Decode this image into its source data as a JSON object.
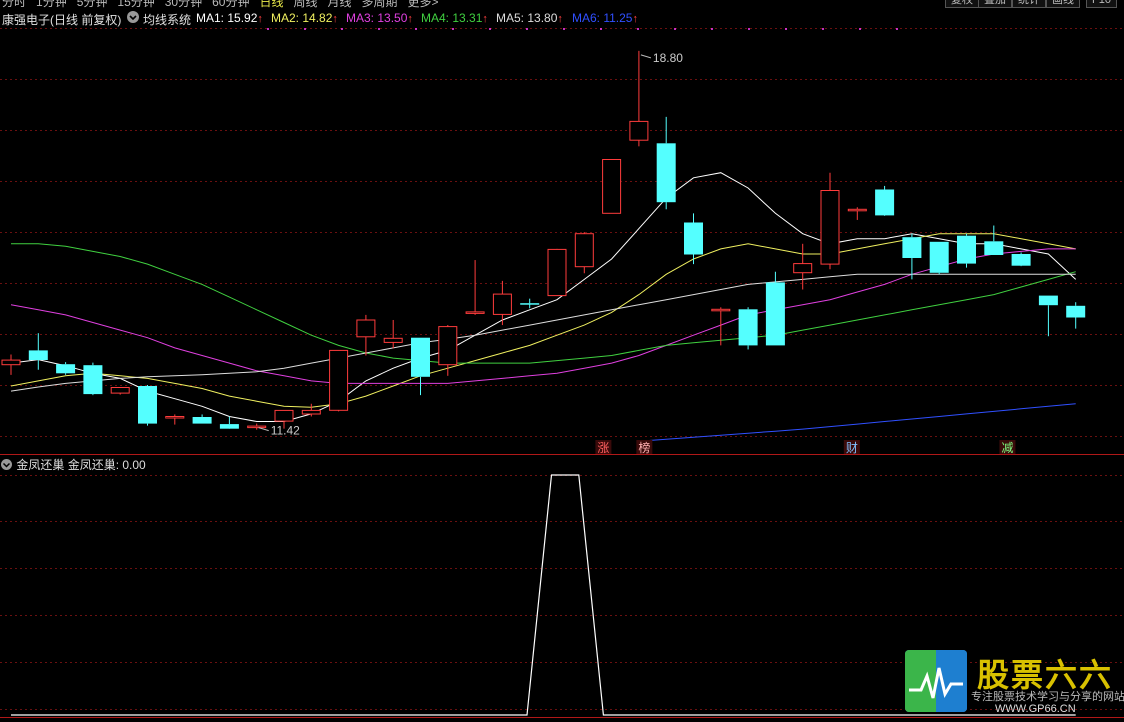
{
  "toolbar": {
    "periods": [
      "分时",
      "1分钟",
      "5分钟",
      "15分钟",
      "30分钟",
      "60分钟",
      "日线",
      "周线",
      "月线",
      "多周期",
      "更多>"
    ],
    "active_period": "日线",
    "right_buttons": [
      "复权",
      "叠加",
      "统计",
      "画线",
      "F10"
    ]
  },
  "header": {
    "stock": "康强电子(日线 前复权)",
    "indicator": "均线系统",
    "ma": [
      {
        "label": "MA1: 15.92",
        "color": "#ffffff"
      },
      {
        "label": "MA2: 14.82",
        "color": "#f0f060"
      },
      {
        "label": "MA3: 13.50",
        "color": "#e040e0"
      },
      {
        "label": "MA4: 13.31",
        "color": "#40d040"
      },
      {
        "label": "MA5: 13.80",
        "color": "#dddddd"
      },
      {
        "label": "MA6: 11.25",
        "color": "#3050ff"
      }
    ],
    "up_arrow": "↑"
  },
  "indicator_panel": {
    "name": "金凤还巢",
    "value_label": "金凤还巢: 0.00"
  },
  "logo": {
    "title": "股票六六",
    "subtitle": "专注股票技术学习与分享的网站",
    "url": "WWW.GP66.CN"
  },
  "chart_data": [
    {
      "type": "candlestick",
      "title": "康强电子(日线 前复权)",
      "ylim": [
        10.9,
        19.25
      ],
      "annotations": {
        "high": "18.80",
        "low": "11.42"
      },
      "colors": {
        "up": "#ff3c3c",
        "down": "#54ffff",
        "grid": "#6a1010"
      },
      "candles": [
        {
          "o": 12.62,
          "h": 12.82,
          "l": 12.42,
          "c": 12.71
        },
        {
          "o": 12.9,
          "h": 13.24,
          "l": 12.52,
          "c": 12.71
        },
        {
          "o": 12.63,
          "h": 12.67,
          "l": 12.42,
          "c": 12.45
        },
        {
          "o": 12.61,
          "h": 12.66,
          "l": 12.02,
          "c": 12.04
        },
        {
          "o": 12.06,
          "h": 12.18,
          "l": 12.03,
          "c": 12.17
        },
        {
          "o": 12.2,
          "h": 12.22,
          "l": 11.42,
          "c": 11.46
        },
        {
          "o": 11.59,
          "h": 11.64,
          "l": 11.44,
          "c": 11.6
        },
        {
          "o": 11.59,
          "h": 11.64,
          "l": 11.46,
          "c": 11.46
        },
        {
          "o": 11.45,
          "h": 11.6,
          "l": 11.37,
          "c": 11.36
        },
        {
          "o": 11.41,
          "h": 11.46,
          "l": 11.34,
          "c": 11.41
        },
        {
          "o": 11.51,
          "h": 11.72,
          "l": 11.36,
          "c": 11.72
        },
        {
          "o": 11.65,
          "h": 11.85,
          "l": 11.6,
          "c": 11.72
        },
        {
          "o": 11.72,
          "h": 12.9,
          "l": 11.7,
          "c": 12.9
        },
        {
          "o": 13.17,
          "h": 13.6,
          "l": 12.8,
          "c": 13.5
        },
        {
          "o": 13.06,
          "h": 13.5,
          "l": 12.94,
          "c": 13.14
        },
        {
          "o": 13.15,
          "h": 13.15,
          "l": 12.02,
          "c": 12.38
        },
        {
          "o": 12.62,
          "h": 13.4,
          "l": 12.4,
          "c": 13.37
        },
        {
          "o": 13.66,
          "h": 14.68,
          "l": 13.6,
          "c": 13.66
        },
        {
          "o": 13.61,
          "h": 14.27,
          "l": 13.4,
          "c": 14.01
        },
        {
          "o": 13.83,
          "h": 13.92,
          "l": 13.73,
          "c": 13.82
        },
        {
          "o": 13.98,
          "h": 14.9,
          "l": 13.98,
          "c": 14.89
        },
        {
          "o": 14.55,
          "h": 15.23,
          "l": 14.42,
          "c": 15.2
        },
        {
          "o": 15.6,
          "h": 16.4,
          "l": 15.6,
          "c": 16.66
        },
        {
          "o": 17.04,
          "h": 18.8,
          "l": 16.92,
          "c": 17.41
        },
        {
          "o": 16.98,
          "h": 17.5,
          "l": 15.68,
          "c": 15.82
        },
        {
          "o": 15.42,
          "h": 15.6,
          "l": 14.6,
          "c": 14.79
        },
        {
          "o": 13.71,
          "h": 13.75,
          "l": 13.0,
          "c": 13.71
        },
        {
          "o": 13.71,
          "h": 13.75,
          "l": 12.92,
          "c": 13.0
        },
        {
          "o": 14.24,
          "h": 14.45,
          "l": 13.0,
          "c": 13.0
        },
        {
          "o": 14.43,
          "h": 15.0,
          "l": 14.1,
          "c": 14.61
        },
        {
          "o": 14.6,
          "h": 16.4,
          "l": 14.5,
          "c": 16.05
        },
        {
          "o": 15.68,
          "h": 15.72,
          "l": 15.47,
          "c": 15.68
        },
        {
          "o": 16.07,
          "h": 16.14,
          "l": 15.55,
          "c": 15.56
        },
        {
          "o": 15.13,
          "h": 15.2,
          "l": 14.3,
          "c": 14.72
        },
        {
          "o": 15.04,
          "h": 15.04,
          "l": 14.4,
          "c": 14.43
        },
        {
          "o": 15.16,
          "h": 15.2,
          "l": 14.53,
          "c": 14.61
        },
        {
          "o": 15.05,
          "h": 15.36,
          "l": 14.78,
          "c": 14.78
        },
        {
          "o": 14.8,
          "h": 14.83,
          "l": 14.56,
          "c": 14.57
        },
        {
          "o": 13.98,
          "h": 13.98,
          "l": 13.18,
          "c": 13.79
        },
        {
          "o": 13.78,
          "h": 13.85,
          "l": 13.33,
          "c": 13.55
        }
      ],
      "ma_series": [
        {
          "name": "MA1",
          "color": "#ffffff",
          "values": [
            12.65,
            12.72,
            12.6,
            12.45,
            12.35,
            12.1,
            11.95,
            11.8,
            11.6,
            11.5,
            11.5,
            11.65,
            11.9,
            12.3,
            12.55,
            12.75,
            12.9,
            13.2,
            13.5,
            13.7,
            13.9,
            14.3,
            14.7,
            15.3,
            15.9,
            16.3,
            16.4,
            16.1,
            15.6,
            15.2,
            15.0,
            15.1,
            15.1,
            15.2,
            15.1,
            15.0,
            15.0,
            14.9,
            14.8,
            14.3
          ]
        },
        {
          "name": "MA2",
          "color": "#f0f060",
          "values": [
            12.2,
            12.3,
            12.4,
            12.45,
            12.4,
            12.35,
            12.25,
            12.15,
            12.0,
            11.9,
            11.8,
            11.78,
            11.85,
            12.0,
            12.2,
            12.4,
            12.55,
            12.7,
            12.85,
            13.0,
            13.2,
            13.4,
            13.65,
            14.0,
            14.4,
            14.7,
            14.9,
            15.0,
            14.9,
            14.8,
            14.8,
            14.9,
            15.0,
            15.1,
            15.2,
            15.2,
            15.2,
            15.1,
            15.0,
            14.9
          ]
        },
        {
          "name": "MA3",
          "color": "#e040e0",
          "values": [
            13.8,
            13.7,
            13.6,
            13.45,
            13.3,
            13.15,
            12.95,
            12.8,
            12.65,
            12.5,
            12.4,
            12.3,
            12.25,
            12.25,
            12.25,
            12.25,
            12.25,
            12.3,
            12.35,
            12.4,
            12.45,
            12.55,
            12.65,
            12.8,
            13.0,
            13.2,
            13.4,
            13.6,
            13.7,
            13.8,
            13.9,
            14.05,
            14.2,
            14.4,
            14.55,
            14.7,
            14.8,
            14.85,
            14.9,
            14.9
          ]
        },
        {
          "name": "MA4",
          "color": "#40d040",
          "values": [
            15.0,
            15.0,
            14.95,
            14.85,
            14.75,
            14.6,
            14.4,
            14.2,
            13.95,
            13.7,
            13.45,
            13.2,
            13.0,
            12.85,
            12.75,
            12.7,
            12.65,
            12.65,
            12.65,
            12.65,
            12.7,
            12.75,
            12.8,
            12.9,
            13.0,
            13.05,
            13.1,
            13.15,
            13.2,
            13.3,
            13.4,
            13.5,
            13.6,
            13.7,
            13.8,
            13.9,
            14.0,
            14.15,
            14.3,
            14.45
          ]
        },
        {
          "name": "MA5",
          "color": "#dddddd",
          "values": [
            12.1,
            12.18,
            12.25,
            12.3,
            12.35,
            12.38,
            12.4,
            12.42,
            12.45,
            12.48,
            12.55,
            12.65,
            12.75,
            12.85,
            12.95,
            13.05,
            13.12,
            13.2,
            13.3,
            13.4,
            13.5,
            13.6,
            13.7,
            13.8,
            13.9,
            14.0,
            14.1,
            14.2,
            14.25,
            14.3,
            14.35,
            14.4,
            14.4,
            14.4,
            14.4,
            14.4,
            14.4,
            14.4,
            14.4,
            14.4
          ]
        },
        {
          "name": "MA6",
          "color": "#3050ff",
          "values": [
            null,
            null,
            null,
            null,
            null,
            null,
            null,
            null,
            null,
            null,
            null,
            null,
            null,
            null,
            null,
            null,
            null,
            null,
            null,
            null,
            null,
            null,
            null,
            11.11,
            11.15,
            11.19,
            11.23,
            11.27,
            11.31,
            11.35,
            11.4,
            11.45,
            11.5,
            11.55,
            11.6,
            11.65,
            11.7,
            11.75,
            11.8,
            11.85
          ]
        }
      ],
      "event_labels": [
        {
          "index": 21.7,
          "text": "涨",
          "color": "#ff6060"
        },
        {
          "index": 23.2,
          "text": "榜",
          "color": "#ffb0b0"
        },
        {
          "index": 30.8,
          "text": "财",
          "color": "#80c0ff"
        },
        {
          "index": 36.5,
          "text": "减",
          "color": "#80ff80"
        }
      ]
    },
    {
      "type": "line",
      "title": "金凤还巢",
      "ylim": [
        0,
        1
      ],
      "x": [
        0,
        18.9,
        19.8,
        20.8,
        21.7,
        39
      ],
      "values": [
        0,
        0,
        1,
        1,
        0,
        0
      ]
    }
  ]
}
